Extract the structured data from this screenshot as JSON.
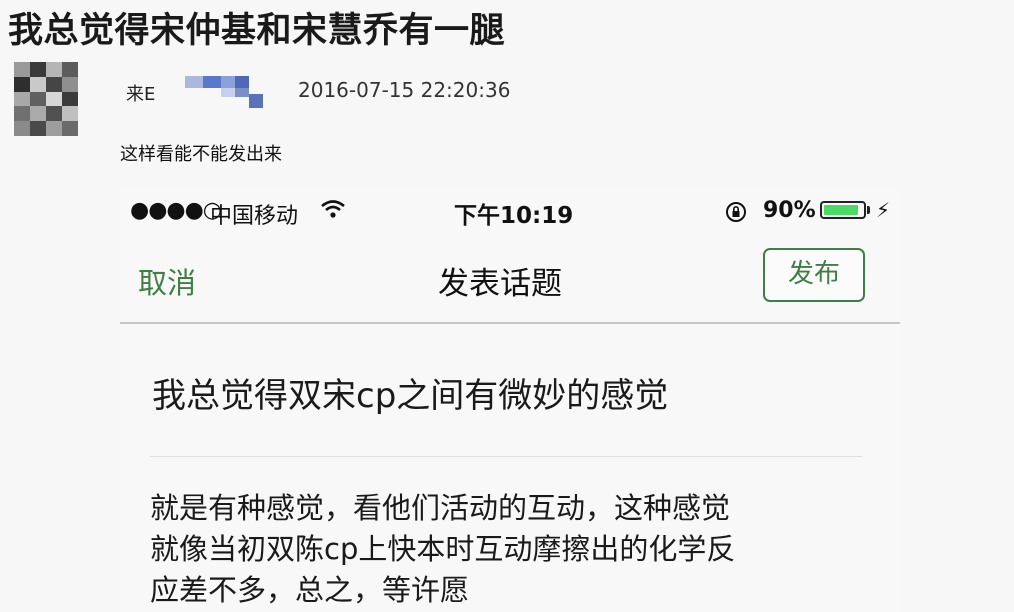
{
  "post": {
    "title": "我总觉得宋仲基和宋慧乔有一腿",
    "from_label": "来E",
    "timestamp": "2016-07-15 22:20:36",
    "body": "这样看能不能发出来"
  },
  "phone": {
    "status_bar": {
      "signal": "●●●●○",
      "carrier": "中国移动",
      "time": "下午10:19",
      "battery": "90%",
      "battery_level": 0.9,
      "battery_color": "#4cd964"
    },
    "navbar": {
      "cancel_label": "取消",
      "title": "发表话题",
      "publish_label": "发布",
      "accent_color": "#3f7e45"
    },
    "topic": {
      "title": "我总觉得双宋cp之间有微妙的感觉",
      "body_lines": [
        "就是有种感觉，看他们活动的互动，这种感觉",
        "就像当初双陈cp上快本时互动摩擦出的化学反",
        "应差不多，总之，等许愿"
      ]
    }
  },
  "icons": {
    "avatar": "pixelated-avatar-icon",
    "wifi": "wifi-icon",
    "lock": "rotation-lock-icon",
    "battery": "battery-icon",
    "charging": "charging-bolt-icon"
  }
}
